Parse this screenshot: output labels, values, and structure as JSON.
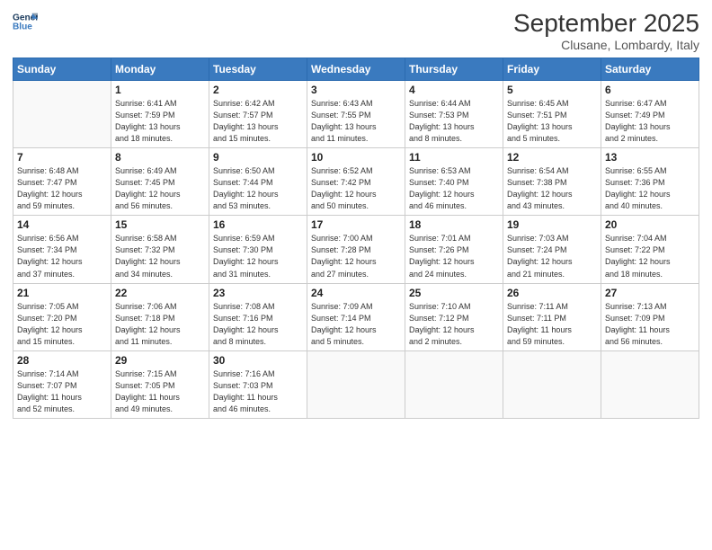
{
  "logo": {
    "line1": "General",
    "line2": "Blue"
  },
  "title": "September 2025",
  "subtitle": "Clusane, Lombardy, Italy",
  "days_header": [
    "Sunday",
    "Monday",
    "Tuesday",
    "Wednesday",
    "Thursday",
    "Friday",
    "Saturday"
  ],
  "weeks": [
    [
      {
        "day": "",
        "info": ""
      },
      {
        "day": "1",
        "info": "Sunrise: 6:41 AM\nSunset: 7:59 PM\nDaylight: 13 hours\nand 18 minutes."
      },
      {
        "day": "2",
        "info": "Sunrise: 6:42 AM\nSunset: 7:57 PM\nDaylight: 13 hours\nand 15 minutes."
      },
      {
        "day": "3",
        "info": "Sunrise: 6:43 AM\nSunset: 7:55 PM\nDaylight: 13 hours\nand 11 minutes."
      },
      {
        "day": "4",
        "info": "Sunrise: 6:44 AM\nSunset: 7:53 PM\nDaylight: 13 hours\nand 8 minutes."
      },
      {
        "day": "5",
        "info": "Sunrise: 6:45 AM\nSunset: 7:51 PM\nDaylight: 13 hours\nand 5 minutes."
      },
      {
        "day": "6",
        "info": "Sunrise: 6:47 AM\nSunset: 7:49 PM\nDaylight: 13 hours\nand 2 minutes."
      }
    ],
    [
      {
        "day": "7",
        "info": "Sunrise: 6:48 AM\nSunset: 7:47 PM\nDaylight: 12 hours\nand 59 minutes."
      },
      {
        "day": "8",
        "info": "Sunrise: 6:49 AM\nSunset: 7:45 PM\nDaylight: 12 hours\nand 56 minutes."
      },
      {
        "day": "9",
        "info": "Sunrise: 6:50 AM\nSunset: 7:44 PM\nDaylight: 12 hours\nand 53 minutes."
      },
      {
        "day": "10",
        "info": "Sunrise: 6:52 AM\nSunset: 7:42 PM\nDaylight: 12 hours\nand 50 minutes."
      },
      {
        "day": "11",
        "info": "Sunrise: 6:53 AM\nSunset: 7:40 PM\nDaylight: 12 hours\nand 46 minutes."
      },
      {
        "day": "12",
        "info": "Sunrise: 6:54 AM\nSunset: 7:38 PM\nDaylight: 12 hours\nand 43 minutes."
      },
      {
        "day": "13",
        "info": "Sunrise: 6:55 AM\nSunset: 7:36 PM\nDaylight: 12 hours\nand 40 minutes."
      }
    ],
    [
      {
        "day": "14",
        "info": "Sunrise: 6:56 AM\nSunset: 7:34 PM\nDaylight: 12 hours\nand 37 minutes."
      },
      {
        "day": "15",
        "info": "Sunrise: 6:58 AM\nSunset: 7:32 PM\nDaylight: 12 hours\nand 34 minutes."
      },
      {
        "day": "16",
        "info": "Sunrise: 6:59 AM\nSunset: 7:30 PM\nDaylight: 12 hours\nand 31 minutes."
      },
      {
        "day": "17",
        "info": "Sunrise: 7:00 AM\nSunset: 7:28 PM\nDaylight: 12 hours\nand 27 minutes."
      },
      {
        "day": "18",
        "info": "Sunrise: 7:01 AM\nSunset: 7:26 PM\nDaylight: 12 hours\nand 24 minutes."
      },
      {
        "day": "19",
        "info": "Sunrise: 7:03 AM\nSunset: 7:24 PM\nDaylight: 12 hours\nand 21 minutes."
      },
      {
        "day": "20",
        "info": "Sunrise: 7:04 AM\nSunset: 7:22 PM\nDaylight: 12 hours\nand 18 minutes."
      }
    ],
    [
      {
        "day": "21",
        "info": "Sunrise: 7:05 AM\nSunset: 7:20 PM\nDaylight: 12 hours\nand 15 minutes."
      },
      {
        "day": "22",
        "info": "Sunrise: 7:06 AM\nSunset: 7:18 PM\nDaylight: 12 hours\nand 11 minutes."
      },
      {
        "day": "23",
        "info": "Sunrise: 7:08 AM\nSunset: 7:16 PM\nDaylight: 12 hours\nand 8 minutes."
      },
      {
        "day": "24",
        "info": "Sunrise: 7:09 AM\nSunset: 7:14 PM\nDaylight: 12 hours\nand 5 minutes."
      },
      {
        "day": "25",
        "info": "Sunrise: 7:10 AM\nSunset: 7:12 PM\nDaylight: 12 hours\nand 2 minutes."
      },
      {
        "day": "26",
        "info": "Sunrise: 7:11 AM\nSunset: 7:11 PM\nDaylight: 11 hours\nand 59 minutes."
      },
      {
        "day": "27",
        "info": "Sunrise: 7:13 AM\nSunset: 7:09 PM\nDaylight: 11 hours\nand 56 minutes."
      }
    ],
    [
      {
        "day": "28",
        "info": "Sunrise: 7:14 AM\nSunset: 7:07 PM\nDaylight: 11 hours\nand 52 minutes."
      },
      {
        "day": "29",
        "info": "Sunrise: 7:15 AM\nSunset: 7:05 PM\nDaylight: 11 hours\nand 49 minutes."
      },
      {
        "day": "30",
        "info": "Sunrise: 7:16 AM\nSunset: 7:03 PM\nDaylight: 11 hours\nand 46 minutes."
      },
      {
        "day": "",
        "info": ""
      },
      {
        "day": "",
        "info": ""
      },
      {
        "day": "",
        "info": ""
      },
      {
        "day": "",
        "info": ""
      }
    ]
  ]
}
